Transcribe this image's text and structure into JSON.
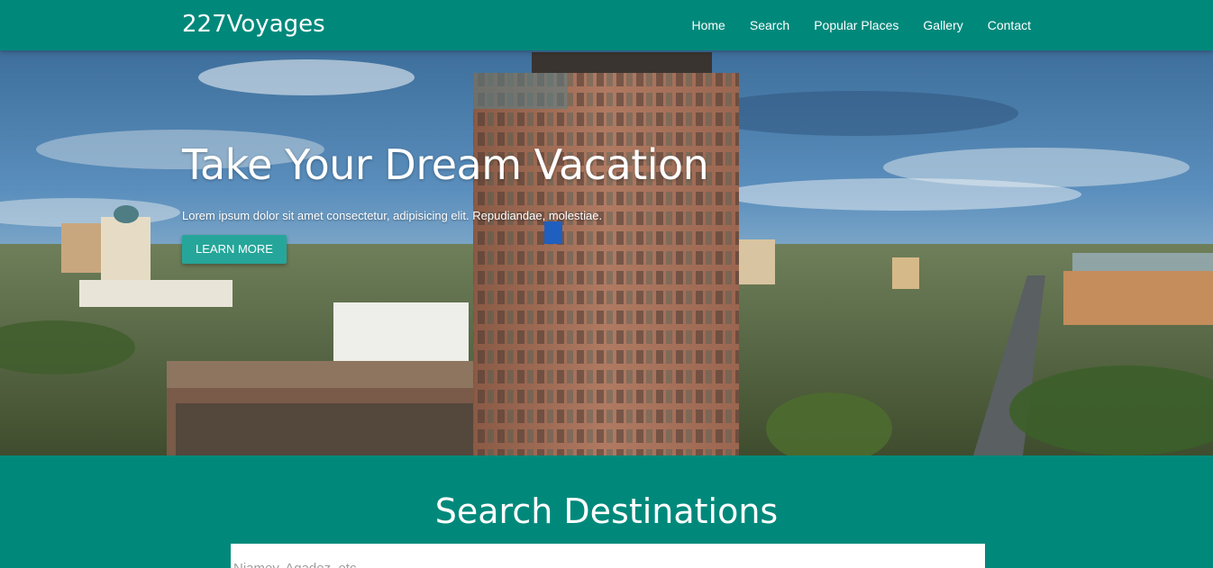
{
  "nav": {
    "brand": "227Voyages",
    "links": [
      "Home",
      "Search",
      "Popular Places",
      "Gallery",
      "Contact"
    ]
  },
  "hero": {
    "title": "Take Your Dream Vacation",
    "text": "Lorem ipsum dolor sit amet consectetur, adipisicing elit. Repudiandae, molestiae.",
    "button": "LEARN MORE"
  },
  "search": {
    "title": "Search Destinations",
    "placeholder": "Niamey, Agadez, etc"
  },
  "colors": {
    "primary": "#00897b",
    "button": "#26a69a"
  }
}
